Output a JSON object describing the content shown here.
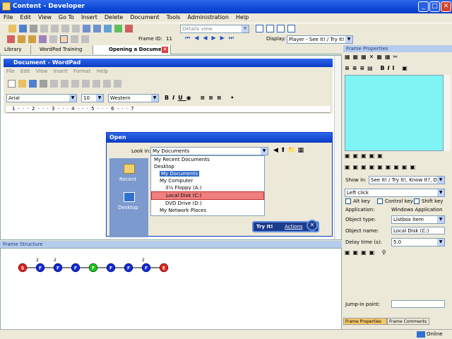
{
  "window": {
    "title": "Content - Developer"
  },
  "menu": [
    "File",
    "Edit",
    "View",
    "Go To",
    "Insert",
    "Delete",
    "Document",
    "Tools",
    "Administration",
    "Help"
  ],
  "toolbar1": {
    "details_view": "Details view"
  },
  "toolbar2": {
    "frame_id_label": "Frame ID:",
    "frame_id": "11",
    "display_label": "Display:",
    "display_value": "Player - See It! / Try It!"
  },
  "tabs": [
    {
      "label": "Library"
    },
    {
      "label": "WordPad Training"
    },
    {
      "label": "Opening a Document"
    }
  ],
  "wordpad": {
    "title": "Document - WordPad",
    "menu": [
      "File",
      "Edit",
      "View",
      "Insert",
      "Format",
      "Help"
    ],
    "font": "Arial",
    "size": "10",
    "script": "Western",
    "ruler": "1 · · · 2 · · · 3 · · · 4 · · · 5 · · · 6 · · · 7"
  },
  "open_dialog": {
    "title": "Open",
    "look_in_label": "Look in:",
    "look_in_value": "My Documents",
    "places": [
      "Recent",
      "Desktop"
    ],
    "list": [
      "My Recent Documents",
      "Desktop",
      "My Documents",
      "My Computer",
      "3½ Floppy (A:)",
      "Local Disk (C:)",
      "DVD Drive (D:)",
      "My Network Places"
    ],
    "callout_title": "Try It!",
    "callout_action": "Actions"
  },
  "frame_structure": {
    "title": "Frame Structure",
    "nodes": [
      {
        "label": "S",
        "color": "#e02020",
        "badge": ""
      },
      {
        "label": "F",
        "color": "#1028d8",
        "badge": "2"
      },
      {
        "label": "F",
        "color": "#1028d8",
        "badge": "2"
      },
      {
        "label": "F",
        "color": "#1028d8",
        "badge": ""
      },
      {
        "label": "F",
        "color": "#18c018",
        "badge": ""
      },
      {
        "label": "F",
        "color": "#1028d8",
        "badge": ""
      },
      {
        "label": "F",
        "color": "#1028d8",
        "badge": ""
      },
      {
        "label": "F",
        "color": "#1028d8",
        "badge": "2"
      },
      {
        "label": "E",
        "color": "#e02020",
        "badge": ""
      }
    ]
  },
  "frame_properties": {
    "title": "Frame Properties",
    "show_in_label": "Show in:",
    "show_in_value": "See It! / Try It!, Know It?, Do It!",
    "action": "Left click",
    "alt_key": "Alt key",
    "control_key": "Control key",
    "shift_key": "Shift key",
    "application_label": "Application:",
    "application_value": "Windows Application",
    "object_type_label": "Object type:",
    "object_type_value": "Listbox item",
    "object_name_label": "Object name:",
    "object_name_value": "Local Disk (C:)",
    "delay_label": "Delay time (s):",
    "delay_value": "5.0",
    "jump_in_label": "Jump-in point:",
    "tab_props": "Frame Properties",
    "tab_comments": "Frame Comments"
  },
  "status": {
    "online": "Online"
  }
}
